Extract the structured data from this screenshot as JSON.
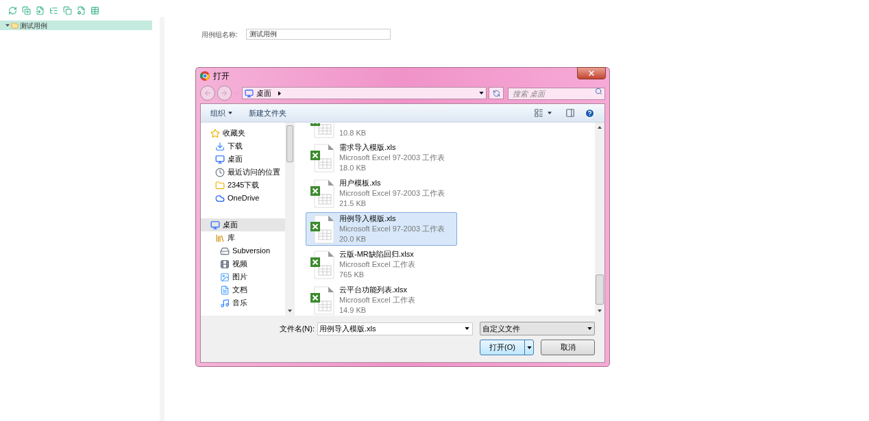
{
  "tree": [
    {
      "label": "测试用例",
      "expanded": true,
      "selected": true
    }
  ],
  "form": {
    "label": "用例组名称:",
    "value": "测试用例"
  },
  "dialog": {
    "title": "打开",
    "address": "桌面",
    "search_placeholder": "搜索 桌面",
    "toolbar": {
      "organize": "组织",
      "new_folder": "新建文件夹"
    },
    "nav": [
      {
        "label": "收藏夹",
        "kind": "star",
        "children": [
          {
            "label": "下载",
            "kind": "download"
          },
          {
            "label": "桌面",
            "kind": "desktop"
          },
          {
            "label": "最近访问的位置",
            "kind": "recent"
          },
          {
            "label": "2345下载",
            "kind": "folder"
          },
          {
            "label": "OneDrive",
            "kind": "cloud"
          }
        ]
      },
      {
        "label": "桌面",
        "kind": "desktop",
        "selected": true,
        "children": [
          {
            "label": "库",
            "kind": "library",
            "children": [
              {
                "label": "Subversion",
                "kind": "drive"
              },
              {
                "label": "视频",
                "kind": "video"
              },
              {
                "label": "图片",
                "kind": "picture"
              },
              {
                "label": "文档",
                "kind": "doc"
              },
              {
                "label": "音乐",
                "kind": "music"
              }
            ]
          }
        ]
      }
    ],
    "files": [
      {
        "size": "10.8 KB",
        "selected": false
      },
      {
        "name": "需求导入模版.xls",
        "type": "Microsoft Excel 97-2003 工作表",
        "size": "18.0 KB",
        "selected": false
      },
      {
        "name": "用户模板.xls",
        "type": "Microsoft Excel 97-2003 工作表",
        "size": "21.5 KB",
        "selected": false
      },
      {
        "name": "用例导入模版.xls",
        "type": "Microsoft Excel 97-2003 工作表",
        "size": "20.0 KB",
        "selected": true
      },
      {
        "name": "云版-MR缺陷回归.xlsx",
        "type": "Microsoft Excel 工作表",
        "size": "765 KB",
        "selected": false
      },
      {
        "name": "云平台功能列表.xlsx",
        "type": "Microsoft Excel 工作表",
        "size": "14.9 KB",
        "selected": false
      }
    ],
    "filename_label": "文件名(N):",
    "filename": "用例导入模版.xls",
    "filter": "自定义文件",
    "open_button": "打开(O)",
    "cancel_button": "取消"
  }
}
